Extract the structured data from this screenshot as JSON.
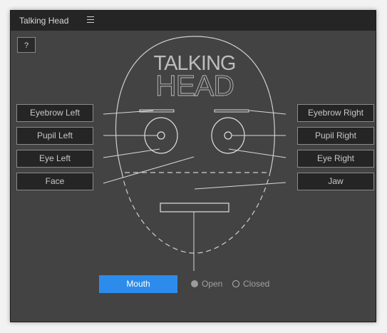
{
  "window": {
    "title": "Talking Head",
    "menu_icon": "hamburger-menu-icon"
  },
  "help": {
    "label": "?"
  },
  "logo": {
    "line1": "TALKING",
    "line2": "HEAD"
  },
  "left_buttons": [
    {
      "label": "Eyebrow Left"
    },
    {
      "label": "Pupil Left"
    },
    {
      "label": "Eye Left"
    },
    {
      "label": "Face"
    }
  ],
  "right_buttons": [
    {
      "label": "Eyebrow Right"
    },
    {
      "label": "Pupil Right"
    },
    {
      "label": "Eye Right"
    },
    {
      "label": "Jaw"
    }
  ],
  "mouth": {
    "button_label": "Mouth",
    "options": [
      {
        "label": "Open",
        "selected": true
      },
      {
        "label": "Closed",
        "selected": false
      }
    ]
  },
  "colors": {
    "panel_bg": "#434343",
    "titlebar_bg": "#252525",
    "accent": "#2d8ceb",
    "line": "#d8d8d8"
  }
}
